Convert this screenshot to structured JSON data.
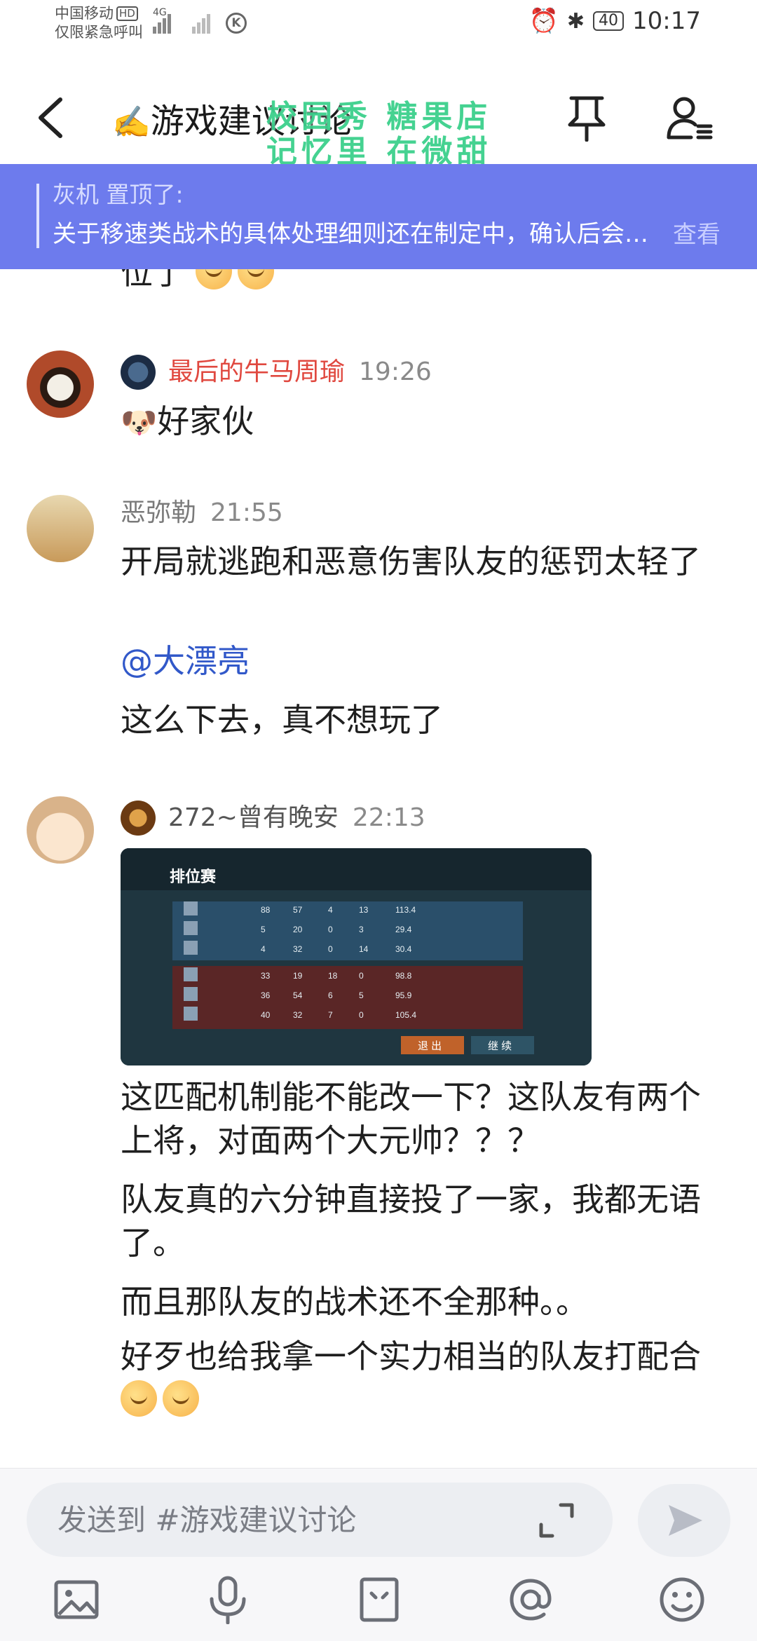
{
  "status_bar": {
    "carrier": "中国移动",
    "hd": "HD",
    "emergency": "仅限紧急呼叫",
    "network": "4G",
    "battery": "40",
    "time": "10:17"
  },
  "header": {
    "title": "游戏建议讨论",
    "title_icon": "writing-hand-emoji",
    "watermark_line1": "校园秀 糖果店",
    "watermark_line2": "记忆里 在微甜"
  },
  "pinned": {
    "label": "灰机 置顶了:",
    "message": "关于移速类战术的具体处理细则还在制定中，确认后会第一时间公告",
    "view": "查看"
  },
  "messages": [
    {
      "partial_text": "位了"
    },
    {
      "name": "最后的牛马周瑜",
      "name_color": "#e0483f",
      "time": "19:26",
      "text": "好家伙"
    },
    {
      "name": "恶弥勒",
      "name_color": "#7a7a7a",
      "time": "21:55",
      "lines": [
        "开局就逃跑和恶意伤害队友的惩罚太轻了",
        "@大漂亮",
        "这么下去，真不想玩了"
      ]
    },
    {
      "name": "272~曾有晚安",
      "name_color": "#555555",
      "time": "22:13",
      "lines": [
        "这匹配机制能不能改一下？这队友有两个上将，对面两个大元帅？？？",
        "队友真的六分钟直接投了一家，我都无语了。",
        "而且那队友的战术还不全那种。。",
        "好歹也给我拿一个实力相当的队友打配合"
      ]
    }
  ],
  "screenshot": {
    "title": "排位赛",
    "headers": [
      "",
      "",
      "",
      "",
      ""
    ],
    "rows": [
      [
        "88",
        "57",
        "4",
        "13",
        "113.4"
      ],
      [
        "5",
        "20",
        "0",
        "3",
        "29.4"
      ],
      [
        "4",
        "32",
        "0",
        "14",
        "30.4"
      ],
      [
        "33",
        "19",
        "18",
        "0",
        "98.8"
      ],
      [
        "36",
        "54",
        "6",
        "5",
        "95.9"
      ],
      [
        "40",
        "32",
        "7",
        "0",
        "105.4"
      ]
    ],
    "exit_label": "退 出",
    "continue_label": "继 续"
  },
  "input": {
    "placeholder": "发送到 #游戏建议讨论"
  },
  "colors": {
    "pinned_bg": "#6d7bed",
    "mention": "#3158c9",
    "watermark": "#3cd08c"
  }
}
